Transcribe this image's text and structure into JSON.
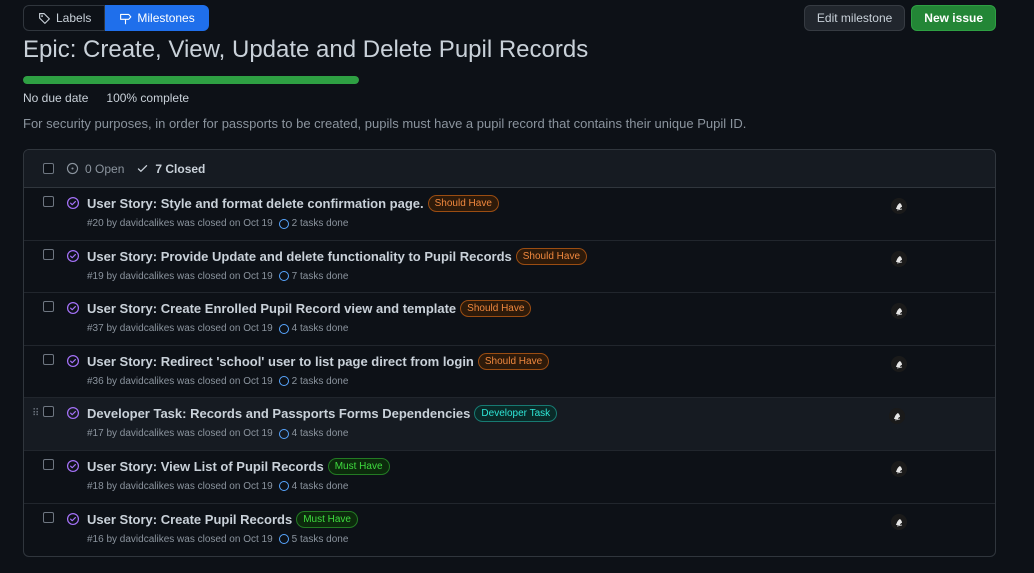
{
  "nav": {
    "labels_label": "Labels",
    "milestones_label": "Milestones"
  },
  "actions": {
    "edit_label": "Edit milestone",
    "new_issue_label": "New issue"
  },
  "milestone": {
    "title": "Epic: Create, View, Update and Delete Pupil Records",
    "due": "No due date",
    "complete": "100% complete",
    "progress_fraction": 1.0,
    "description": "For security purposes, in order for passports to be created, pupils must have a pupil record that contains their unique Pupil ID."
  },
  "list_header": {
    "open_label": "0 Open",
    "closed_label": "7 Closed"
  },
  "issues": [
    {
      "title": "User Story: Style and format delete confirmation page.",
      "label": "Should Have",
      "label_kind": "should",
      "meta": "#20 by davidcalikes was closed on Oct 19",
      "tasks": "2 tasks done"
    },
    {
      "title": "User Story: Provide Update and delete functionality to Pupil Records",
      "label": "Should Have",
      "label_kind": "should",
      "meta": "#19 by davidcalikes was closed on Oct 19",
      "tasks": "7 tasks done"
    },
    {
      "title": "User Story: Create Enrolled Pupil Record view and template",
      "label": "Should Have",
      "label_kind": "should",
      "meta": "#37 by davidcalikes was closed on Oct 19",
      "tasks": "4 tasks done"
    },
    {
      "title": "User Story: Redirect 'school' user to list page direct from login",
      "label": "Should Have",
      "label_kind": "should",
      "meta": "#36 by davidcalikes was closed on Oct 19",
      "tasks": "2 tasks done"
    },
    {
      "title": "Developer Task: Records and Passports Forms Dependencies",
      "label": "Developer Task",
      "label_kind": "dev",
      "meta": "#17 by davidcalikes was closed on Oct 19",
      "tasks": "4 tasks done"
    },
    {
      "title": "User Story: View List of Pupil Records",
      "label": "Must Have",
      "label_kind": "must",
      "meta": "#18 by davidcalikes was closed on Oct 19",
      "tasks": "4 tasks done"
    },
    {
      "title": "User Story: Create Pupil Records",
      "label": "Must Have",
      "label_kind": "must",
      "meta": "#16 by davidcalikes was closed on Oct 19",
      "tasks": "5 tasks done"
    }
  ],
  "colors": {
    "accent": "#1f6feb",
    "success": "#238636",
    "closed_icon": "#a371f7"
  },
  "icons": {
    "labels": "tag-icon",
    "milestones": "milestone-icon",
    "open": "issue-opened-icon",
    "closed": "check-icon",
    "issue_closed": "issue-closed-icon",
    "tasks": "tasks-circle-icon"
  }
}
